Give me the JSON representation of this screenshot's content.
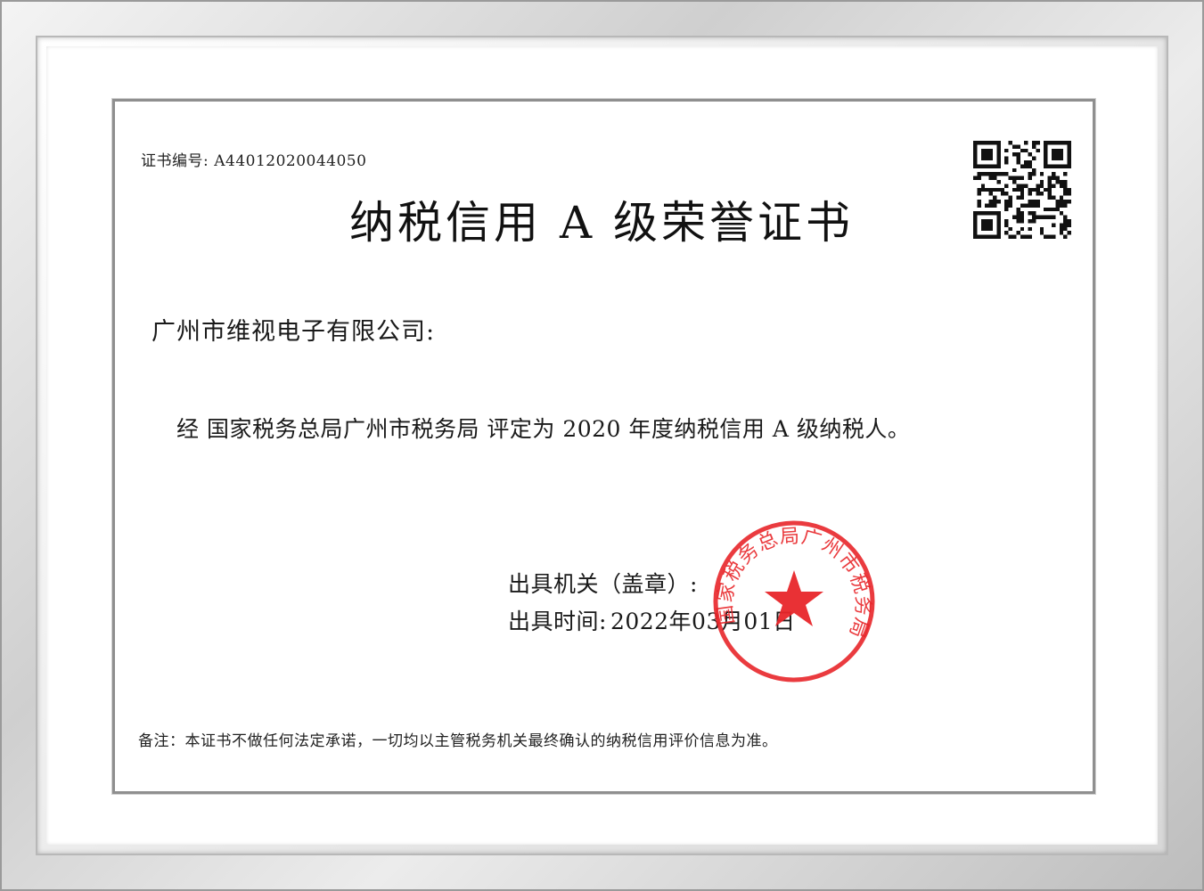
{
  "certificate": {
    "number_label": "证书编号:",
    "number_value": "A44012020044050",
    "title": "纳税信用 A 级荣誉证书",
    "company": "广州市维视电子有限公司:",
    "statement": "经 国家税务总局广州市税务局 评定为 2020 年度纳税信用 A 级纳税人。",
    "issuer_label": "出具机关（盖章）:",
    "date_label": "出具时间:",
    "date_value": "2022年03月01日",
    "note": "备注：本证书不做任何法定承诺，一切均以主管税务机关最终确认的纳税信用评价信息为准。"
  },
  "seal": {
    "text": "国家税务总局广州市税务局",
    "color": "#e8262a"
  },
  "qr_icon": "qr-code-icon"
}
